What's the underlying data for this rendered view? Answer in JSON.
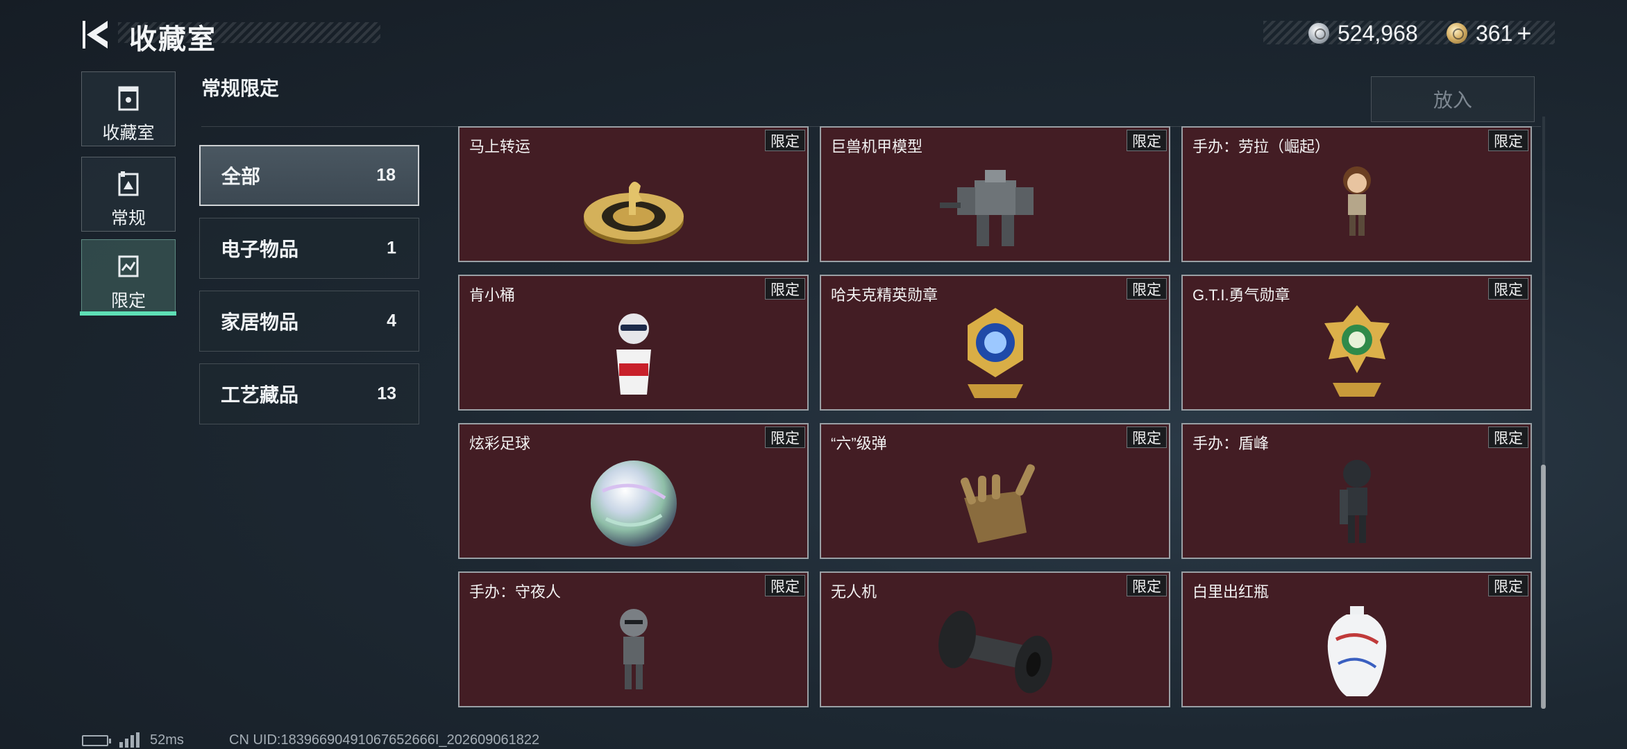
{
  "header": {
    "title": "收藏室"
  },
  "currency": {
    "silver": "524,968",
    "gold": "361",
    "add": "+"
  },
  "nav": [
    {
      "label": "收藏室",
      "icon": "trophy-cabinet-icon"
    },
    {
      "label": "常规",
      "icon": "album-icon"
    },
    {
      "label": "限定",
      "icon": "limited-picture-icon",
      "active": true
    }
  ],
  "section": {
    "label": "常规限定"
  },
  "categories": [
    {
      "label": "全部",
      "count": "18",
      "active": true
    },
    {
      "label": "电子物品",
      "count": "1"
    },
    {
      "label": "家居物品",
      "count": "4"
    },
    {
      "label": "工艺藏品",
      "count": "13"
    }
  ],
  "put_button": {
    "label": "放入"
  },
  "items": [
    {
      "name": "马上转运",
      "tag": "限定",
      "icon": "golden-horse-disc-icon"
    },
    {
      "name": "巨兽机甲模型",
      "tag": "限定",
      "icon": "mech-model-icon"
    },
    {
      "name": "手办：劳拉（崛起）",
      "tag": "限定",
      "icon": "lara-figure-icon"
    },
    {
      "name": "肯小桶",
      "tag": "限定",
      "icon": "kfc-bucket-figure-icon"
    },
    {
      "name": "哈夫克精英勋章",
      "tag": "限定",
      "icon": "blue-gold-medal-icon"
    },
    {
      "name": "G.T.I.勇气勋章",
      "tag": "限定",
      "icon": "green-gold-medal-icon"
    },
    {
      "name": "炫彩足球",
      "tag": "限定",
      "icon": "iridescent-ball-icon"
    },
    {
      "name": "“六”级弹",
      "tag": "限定",
      "icon": "bullet-hand-icon"
    },
    {
      "name": "手办：盾峰",
      "tag": "限定",
      "icon": "soldier-figure-icon"
    },
    {
      "name": "手办：守夜人",
      "tag": "限定",
      "icon": "knight-figure-icon"
    },
    {
      "name": "无人机",
      "tag": "限定",
      "icon": "drone-tube-icon"
    },
    {
      "name": "白里出红瓶",
      "tag": "限定",
      "icon": "porcelain-vase-icon"
    }
  ],
  "status": {
    "ping": "52ms",
    "uid": "CN UID:18396690491067652666I_202609061822"
  },
  "colors": {
    "accent": "#5ee0b6",
    "card_bg": "#431d24"
  }
}
